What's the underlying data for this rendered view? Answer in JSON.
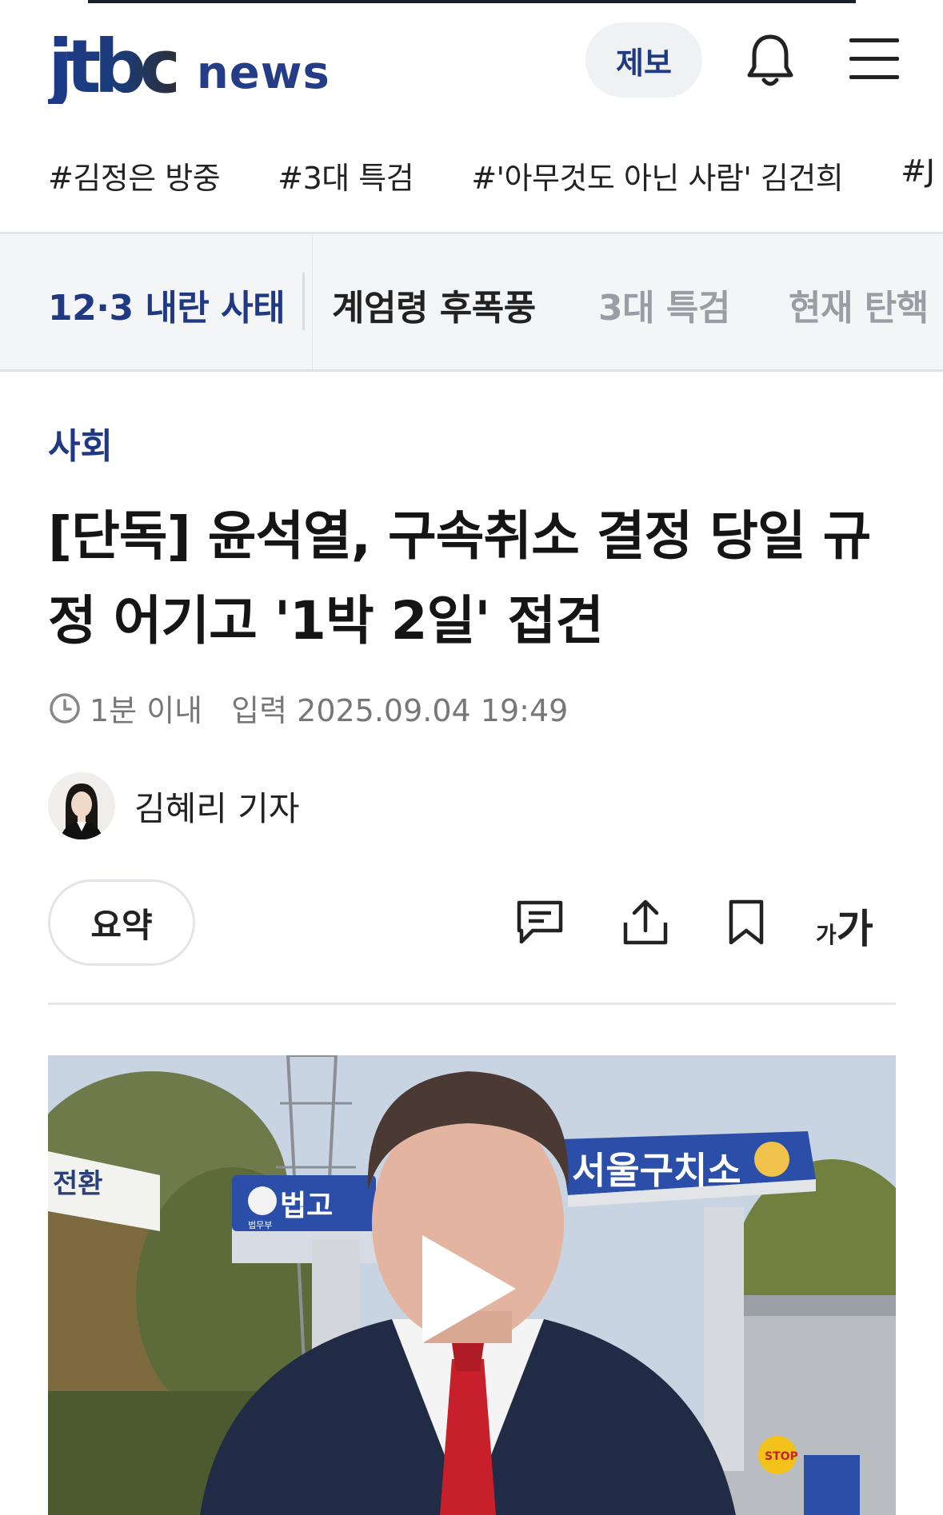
{
  "header": {
    "logo_jtbc": "jtbc",
    "logo_news": "news",
    "report_label": "제보",
    "icons": [
      "bell-icon",
      "menu-icon"
    ]
  },
  "hashtags": [
    "#김정은 방중",
    "#3대 특검",
    "#'아무것도 아닌 사람' 김건희",
    "#J"
  ],
  "categories": {
    "items": [
      "12·3 내란 사태",
      "계엄령 후폭풍",
      "3대 특검",
      "현재 탄핵"
    ],
    "active_index": 0
  },
  "article": {
    "section": "사회",
    "title_line1": "[단독] 윤석열, 구속취소 결정 당일 규",
    "title_line2": "정 어기고 '1박 2일' 접견",
    "time_ago": "1분 이내",
    "published": "입력 2025.09.04 19:49",
    "author": "김혜리 기자"
  },
  "toolbar": {
    "summary_label": "요약",
    "font_small": "가",
    "font_large": "가",
    "icons": [
      "comment-icon",
      "share-icon",
      "bookmark-icon",
      "font-size-icon"
    ]
  },
  "video": {
    "sign_right": "서울구치소",
    "sign_left": "법고",
    "sign_left_small": "법무부",
    "side_sign": "전환",
    "stop_sign": "STOP",
    "colors": {
      "accent": "#1f3a82",
      "sky": "#c9d6e4",
      "sign_blue": "#2b4fa8"
    }
  }
}
